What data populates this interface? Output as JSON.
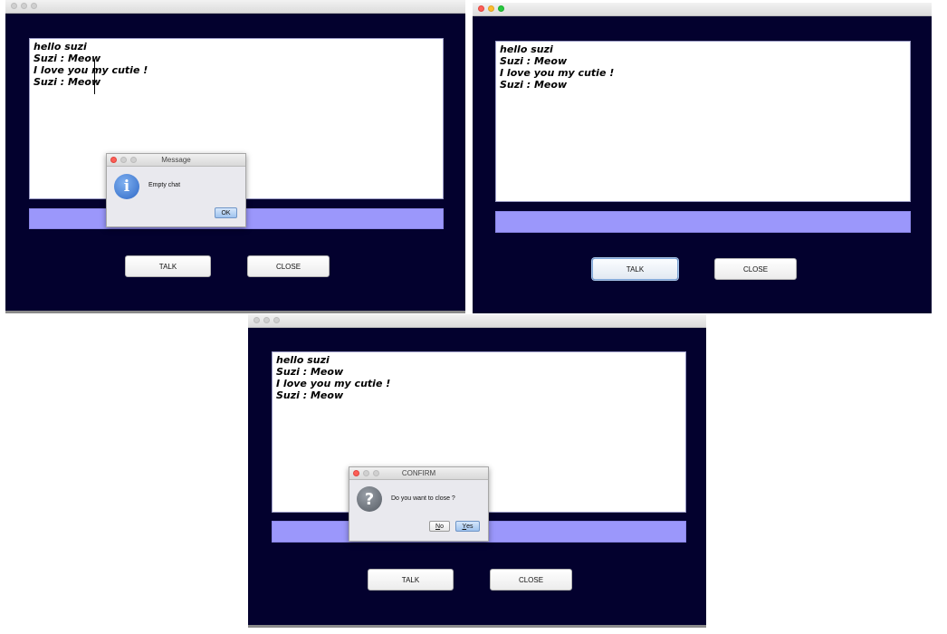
{
  "windows": [
    {
      "chat_lines": [
        "hello suzi",
        "Suzi : Meow",
        "I love you my cutie !",
        "Suzi : Meow"
      ],
      "talk_label": "TALK",
      "close_label": "CLOSE",
      "dialog": {
        "title": "Message",
        "icon": "info-icon",
        "message": "Empty chat",
        "ok_label": "OK"
      }
    },
    {
      "chat_lines": [
        "hello suzi",
        "Suzi : Meow",
        "I love you my cutie !",
        "Suzi : Meow"
      ],
      "talk_label": "TALK",
      "close_label": "CLOSE"
    },
    {
      "chat_lines": [
        "hello suzi",
        "Suzi : Meow",
        "I love you my cutie !",
        "Suzi : Meow"
      ],
      "talk_label": "TALK",
      "close_label": "CLOSE",
      "dialog": {
        "title": "CONFIRM",
        "icon": "question-icon",
        "message": "Do you want to close ?",
        "no_first": "N",
        "no_rest": "o",
        "yes_first": "Y",
        "yes_rest": "es"
      }
    }
  ],
  "colors": {
    "window_bg": "#03012e",
    "input_bar": "#9b97fb",
    "chat_bg": "#ffffff"
  }
}
